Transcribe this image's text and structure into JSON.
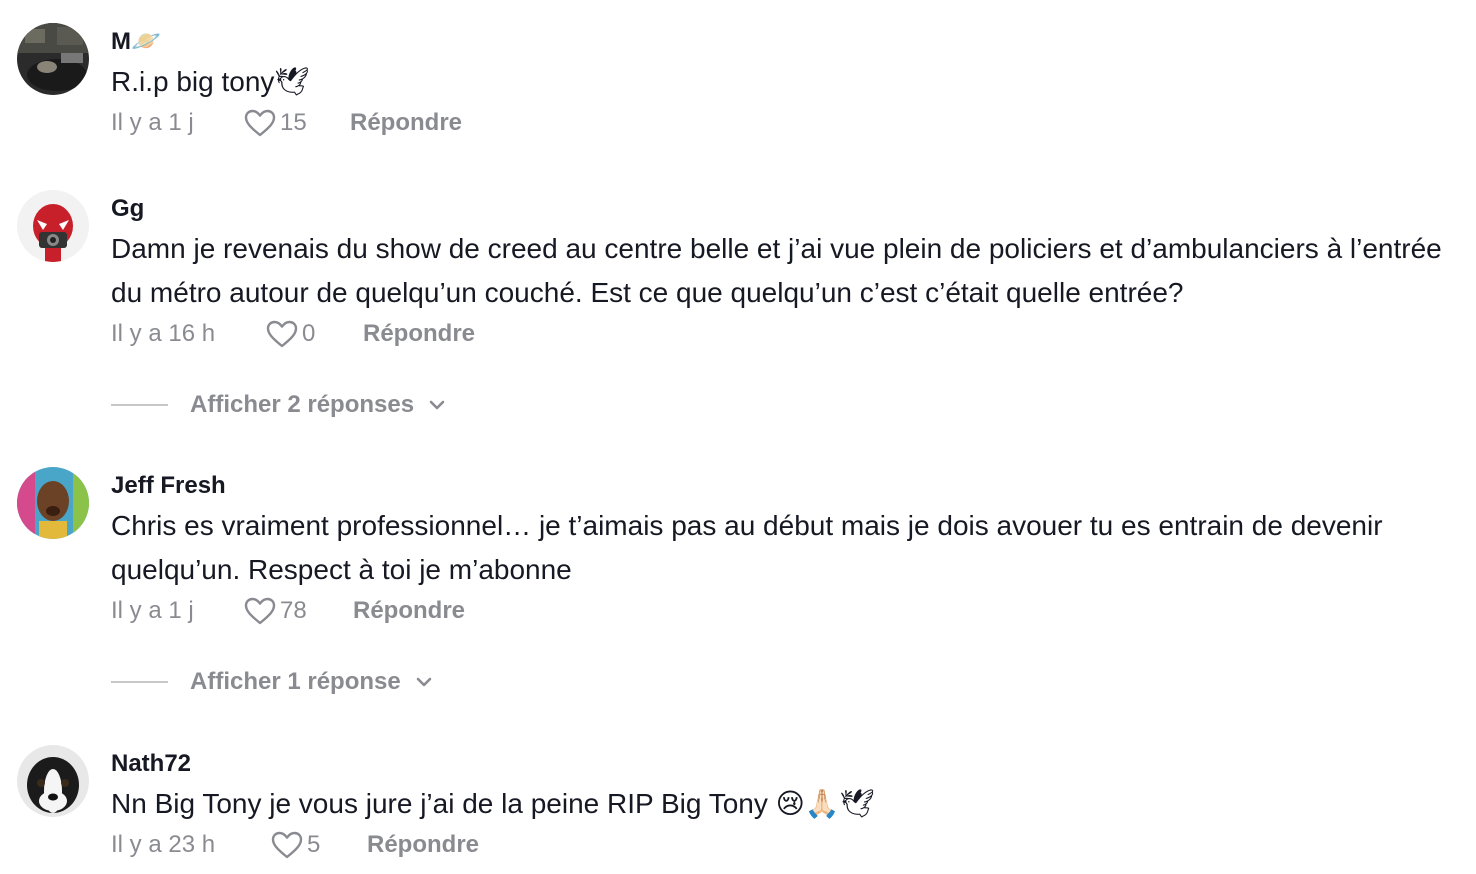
{
  "comments": [
    {
      "username": "M🪐",
      "text": "R.i.p big tony🕊",
      "time": "Il y a 1 j",
      "likes": "15",
      "reply_label": "Répondre",
      "avatar_icon": "avatar-photo"
    },
    {
      "username": "Gg",
      "text": "Damn je revenais du show de creed au centre belle et j’ai vue plein de policiers et d’ambulanciers à l’entrée du métro autour de quelqu’un couché. Est ce que quelqu’un c’est c’était quelle entrée?",
      "time": "Il y a 16 h",
      "likes": "0",
      "reply_label": "Répondre",
      "view_replies": "Afficher 2 réponses",
      "avatar_icon": "spiderman-avatar"
    },
    {
      "username": "Jeff Fresh",
      "text": "Chris es vraiment professionnel… je t’aimais pas au début mais je dois avouer tu es entrain de devenir quelqu’un. Respect à toi je m’abonne",
      "time": "Il y a 1 j",
      "likes": "78",
      "reply_label": "Répondre",
      "view_replies": "Afficher 1 réponse",
      "avatar_icon": "person-avatar"
    },
    {
      "username": "Nath72",
      "text": "Nn Big Tony je vous jure j’ai de la peine RIP Big Tony 😢🙏🏻🕊",
      "time": "Il y a 23 h",
      "likes": "5",
      "reply_label": "Répondre",
      "avatar_icon": "dog-avatar"
    }
  ],
  "colors": {
    "primary_text": "#161823",
    "secondary_text": "#8a8b91",
    "divider": "#c7c7ca"
  }
}
